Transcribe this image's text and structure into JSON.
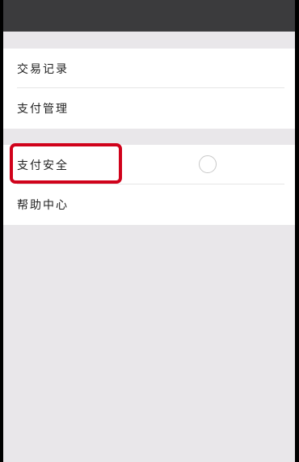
{
  "menu": {
    "groups": [
      {
        "items": [
          {
            "label": "交易记录"
          },
          {
            "label": "支付管理"
          }
        ]
      },
      {
        "items": [
          {
            "label": "支付安全"
          },
          {
            "label": "帮助中心"
          }
        ]
      }
    ]
  },
  "annotation": {
    "highlighted_item": "支付安全",
    "highlight_color": "#d0021b"
  }
}
